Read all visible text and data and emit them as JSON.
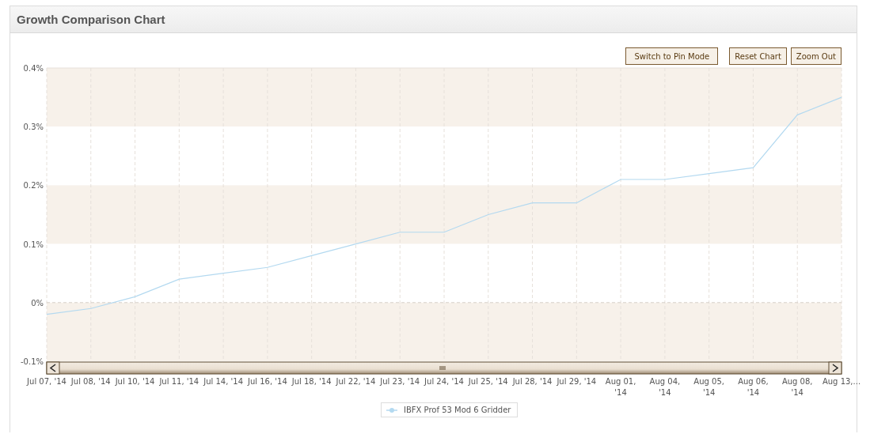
{
  "panel": {
    "title": "Growth Comparison Chart"
  },
  "toolbar": {
    "buttons": [
      "Switch to Pin Mode",
      "Reset Chart",
      "Zoom Out"
    ]
  },
  "chart_data": {
    "type": "line",
    "categories": [
      "Jul 07, '14",
      "Jul 08, '14",
      "Jul 10, '14",
      "Jul 11, '14",
      "Jul 14, '14",
      "Jul 16, '14",
      "Jul 18, '14",
      "Jul 22, '14",
      "Jul 23, '14",
      "Jul 24, '14",
      "Jul 25, '14",
      "Jul 28, '14",
      "Jul 29, '14",
      "Aug 01, '14",
      "Aug 04, '14",
      "Aug 05, '14",
      "Aug 06, '14",
      "Aug 08, '14",
      "Aug 13,..."
    ],
    "series": [
      {
        "name": "IBFX Prof 53 Mod 6 Gridder",
        "color": "#b3d9f0",
        "values": [
          -0.02,
          -0.01,
          0.01,
          0.04,
          0.05,
          0.06,
          0.08,
          0.1,
          0.12,
          0.12,
          0.15,
          0.17,
          0.17,
          0.21,
          0.21,
          0.22,
          0.23,
          0.32,
          0.35
        ]
      }
    ],
    "ylim": [
      -0.1,
      0.4
    ],
    "grid": true,
    "ref_lines": [
      {
        "axis": "y",
        "value": 0
      }
    ],
    "yticks": [
      {
        "value": 0.4,
        "label": "0.4%"
      },
      {
        "value": 0.3,
        "label": "0.3%"
      },
      {
        "value": 0.2,
        "label": "0.2%"
      },
      {
        "value": 0.1,
        "label": "0.1%"
      },
      {
        "value": 0,
        "label": "0%"
      },
      {
        "value": -0.1,
        "label": "-0.1%"
      }
    ]
  }
}
